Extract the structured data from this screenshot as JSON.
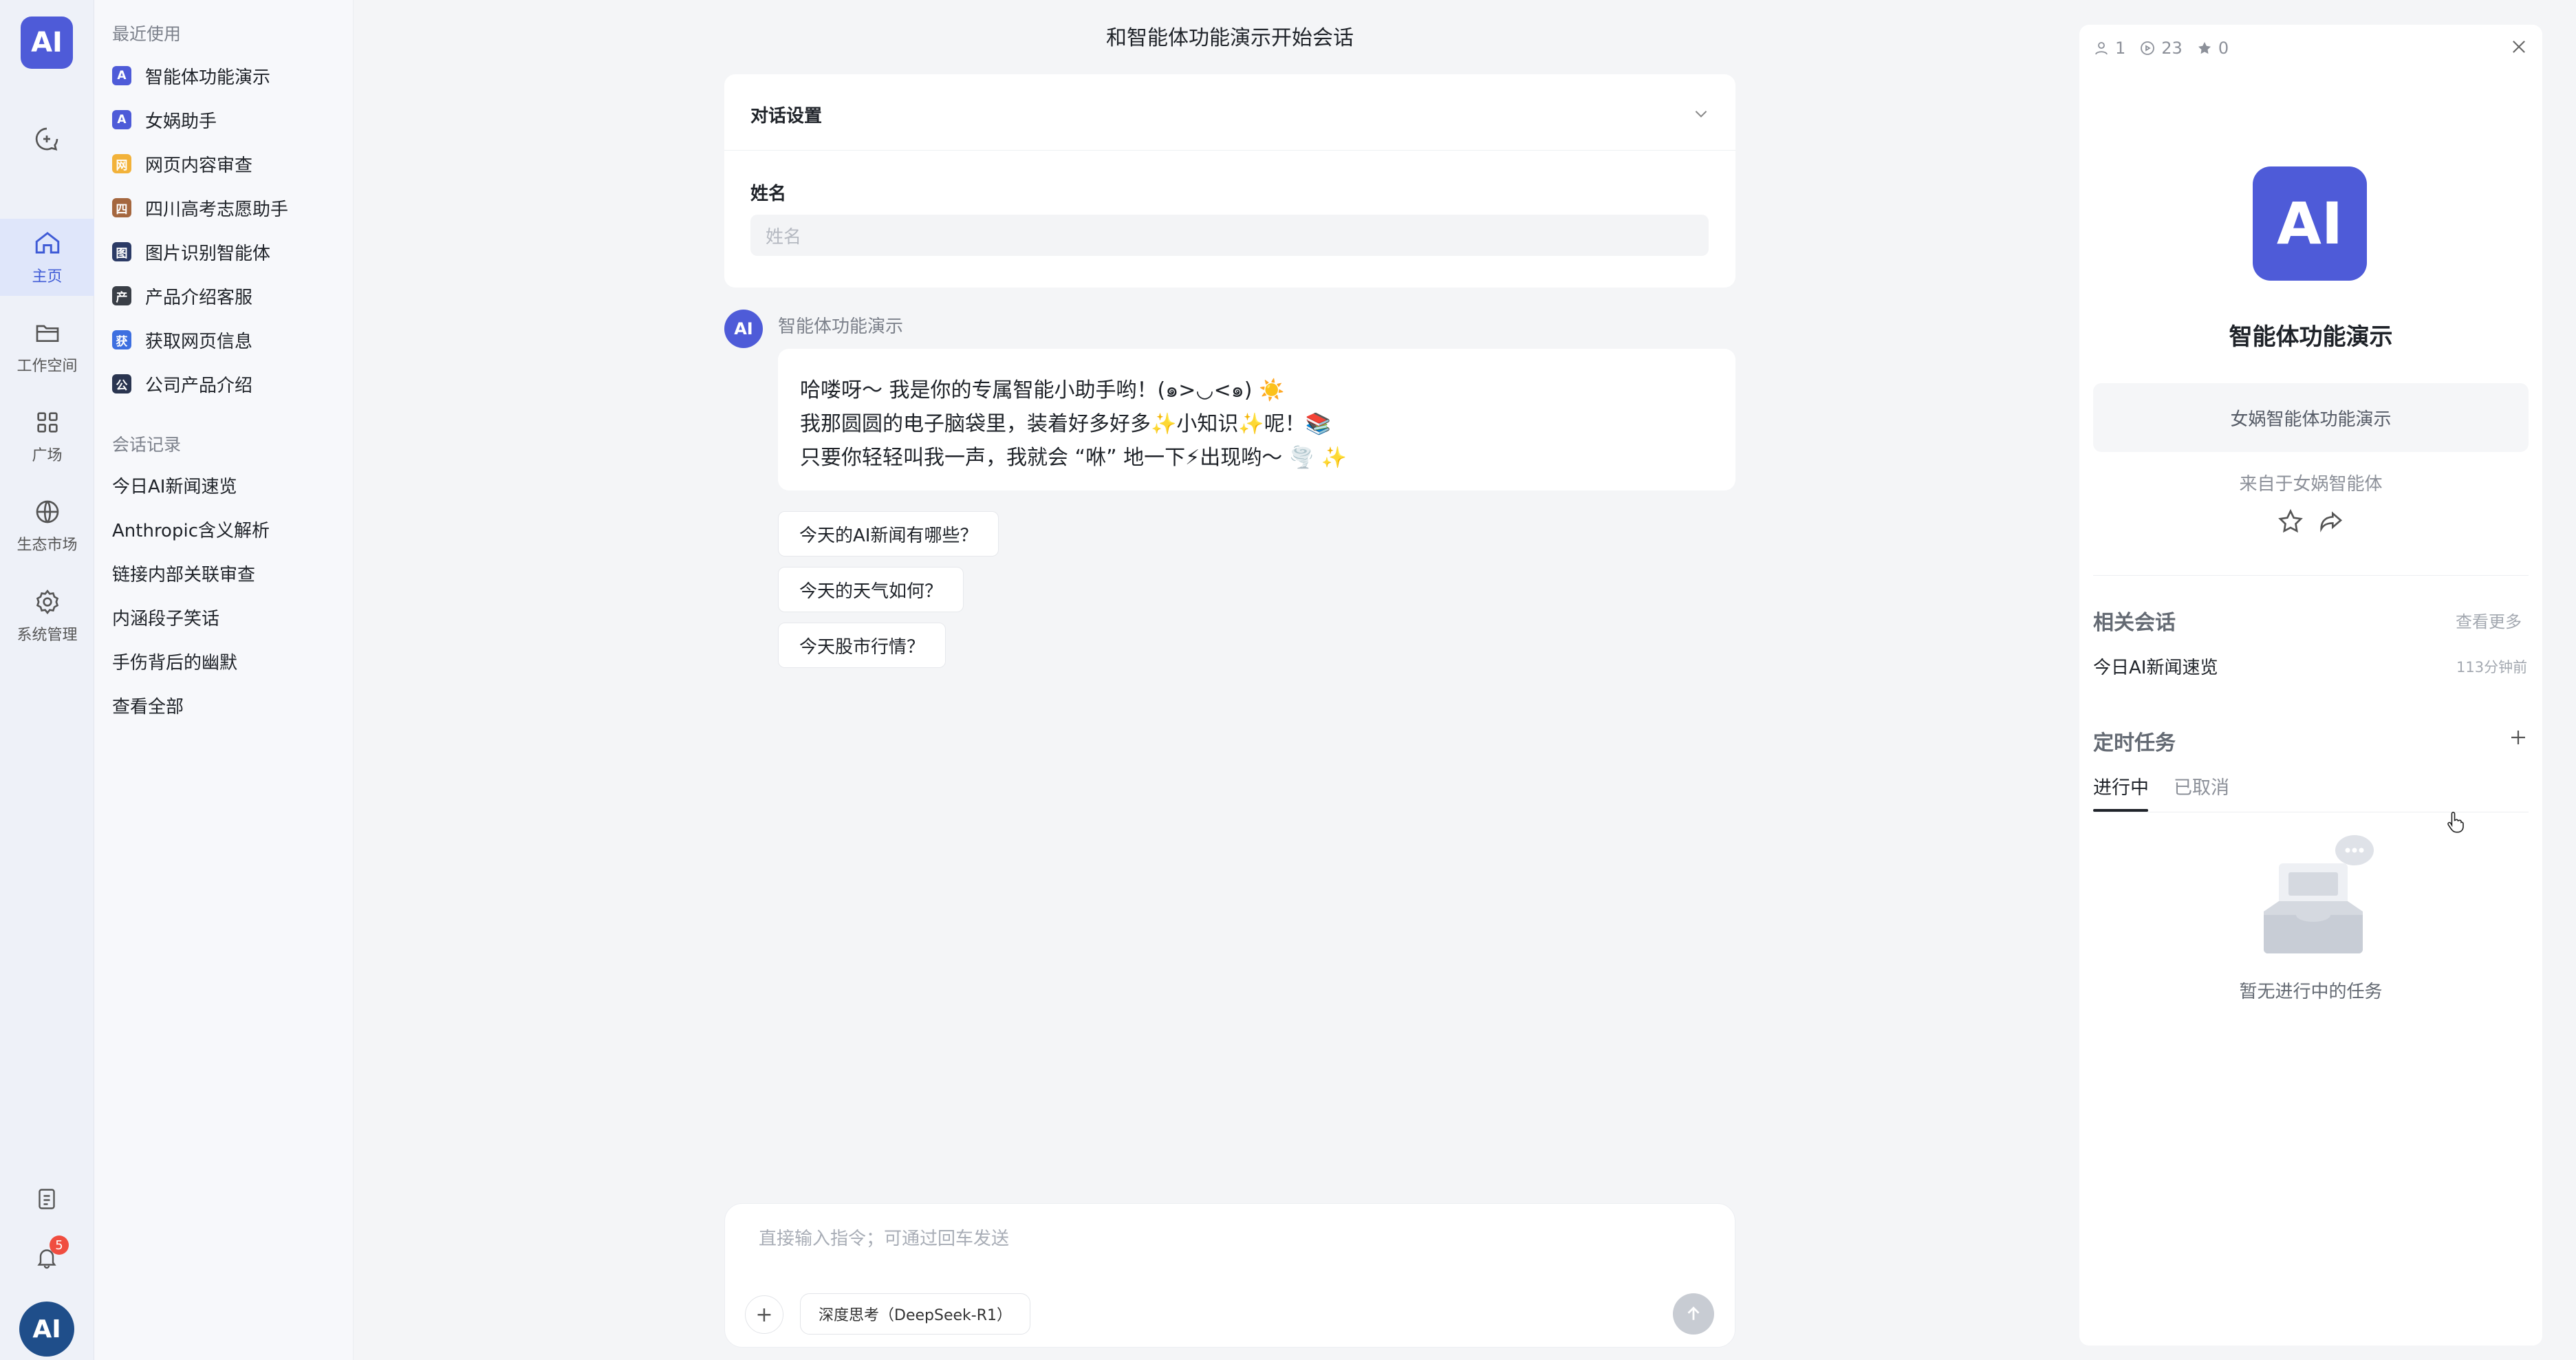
{
  "rail": {
    "logo_text": "AI",
    "items": [
      {
        "label": "主页",
        "icon": "home-icon"
      },
      {
        "label": "工作空间",
        "icon": "folder-icon"
      },
      {
        "label": "广场",
        "icon": "grid-icon"
      },
      {
        "label": "生态市场",
        "icon": "globe-icon"
      },
      {
        "label": "系统管理",
        "icon": "gear-icon"
      }
    ],
    "notification_count": "5",
    "avatar_text": "AI"
  },
  "list": {
    "recent_title": "最近使用",
    "recent_items": [
      {
        "label": "智能体功能演示",
        "color": "#4e5bd8",
        "glyph": "A"
      },
      {
        "label": "女娲助手",
        "color": "#4e5bd8",
        "glyph": "A"
      },
      {
        "label": "网页内容审查",
        "color": "#f2b23a",
        "glyph": "网"
      },
      {
        "label": "四川高考志愿助手",
        "color": "#a5673f",
        "glyph": "四"
      },
      {
        "label": "图片识别智能体",
        "color": "#2c3b66",
        "glyph": "图"
      },
      {
        "label": "产品介绍客服",
        "color": "#3a3f47",
        "glyph": "产"
      },
      {
        "label": "获取网页信息",
        "color": "#3d6fe0",
        "glyph": "获"
      },
      {
        "label": "公司产品介绍",
        "color": "#2a3550",
        "glyph": "公"
      }
    ],
    "history_title": "会话记录",
    "history_items": [
      "今日AI新闻速览",
      "Anthropic含义解析",
      "链接内部关联审查",
      "内涵段子笑话",
      "手伤背后的幽默",
      "查看全部"
    ]
  },
  "chat": {
    "title": "和智能体功能演示开始会话",
    "settings_title": "对话设置",
    "name_label": "姓名",
    "name_placeholder": "姓名",
    "bot_name": "智能体功能演示",
    "bot_avatar_text": "AI",
    "message_lines": [
      "哈喽呀～ 我是你的专属智能小助手哟！(๑>◡<๑) ☀️",
      "我那圆圆的电子脑袋里，装着好多好多✨小知识✨呢！📚",
      "只要你轻轻叫我一声，我就会 “咻” 地一下⚡出现哟～ 🌪️ ✨"
    ],
    "suggestions": [
      "今天的AI新闻有哪些？",
      "今天的天气如何？",
      "今天股市行情？"
    ],
    "input_placeholder": "直接输入指令；可通过回车发送",
    "deep_think_label": "深度思考（DeepSeek-R1）"
  },
  "right": {
    "users_count": "1",
    "views_count": "23",
    "stars_count": "0",
    "agent_name": "智能体功能演示",
    "agent_logo_text": "AI",
    "description": "女娲智能体功能演示",
    "from_text": "来自于女娲智能体",
    "related_title": "相关会话",
    "see_more": "查看更多",
    "related_item": "今日AI新闻速览",
    "related_time": "113分钟前",
    "schedule_title": "定时任务",
    "tab_active": "进行中",
    "tab_inactive": "已取消",
    "empty_text": "暂无进行中的任务"
  }
}
